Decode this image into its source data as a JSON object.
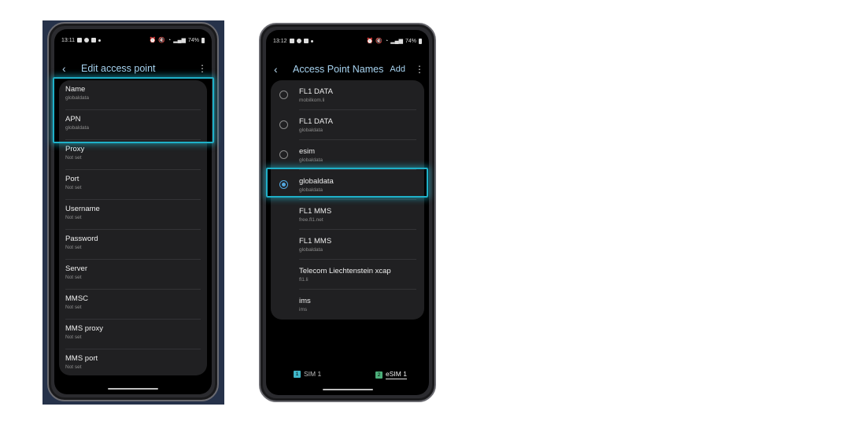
{
  "left_phone": {
    "status": {
      "time": "13:11",
      "battery": "74%"
    },
    "title": "Edit access point",
    "fields": [
      {
        "label": "Name",
        "value": "globaldata"
      },
      {
        "label": "APN",
        "value": "globaldata"
      },
      {
        "label": "Proxy",
        "value": "Not set"
      },
      {
        "label": "Port",
        "value": "Not set"
      },
      {
        "label": "Username",
        "value": "Not set"
      },
      {
        "label": "Password",
        "value": "Not set"
      },
      {
        "label": "Server",
        "value": "Not set"
      },
      {
        "label": "MMSC",
        "value": "Not set"
      },
      {
        "label": "MMS proxy",
        "value": "Not set"
      },
      {
        "label": "MMS port",
        "value": "Not set"
      }
    ]
  },
  "right_phone": {
    "status": {
      "time": "13:12",
      "battery": "74%"
    },
    "title": "Access Point Names",
    "add_label": "Add",
    "apns": [
      {
        "name": "FL1 DATA",
        "apn": "mobilkom.li",
        "has_radio": true,
        "selected": false
      },
      {
        "name": "FL1 DATA",
        "apn": "globaldata",
        "has_radio": true,
        "selected": false
      },
      {
        "name": "esim",
        "apn": "globaldata",
        "has_radio": true,
        "selected": false
      },
      {
        "name": "globaldata",
        "apn": "globaldata",
        "has_radio": true,
        "selected": true
      },
      {
        "name": "FL1 MMS",
        "apn": "free.fl1.net",
        "has_radio": false,
        "selected": false
      },
      {
        "name": "FL1 MMS",
        "apn": "globaldata",
        "has_radio": false,
        "selected": false
      },
      {
        "name": "Telecom Liechtenstein xcap",
        "apn": "fl1.li",
        "has_radio": false,
        "selected": false
      },
      {
        "name": "ims",
        "apn": "ims",
        "has_radio": false,
        "selected": false
      }
    ],
    "sim_tabs": [
      {
        "badge": "1",
        "label": "SIM 1",
        "active": false,
        "color": "#3fb6c8"
      },
      {
        "badge": "2",
        "label": "eSIM 1",
        "active": true,
        "color": "#4caf7a"
      }
    ]
  },
  "colors": {
    "accent": "#a7d3f0",
    "highlight": "#1fb0c8",
    "radio": "#52a8e0"
  }
}
